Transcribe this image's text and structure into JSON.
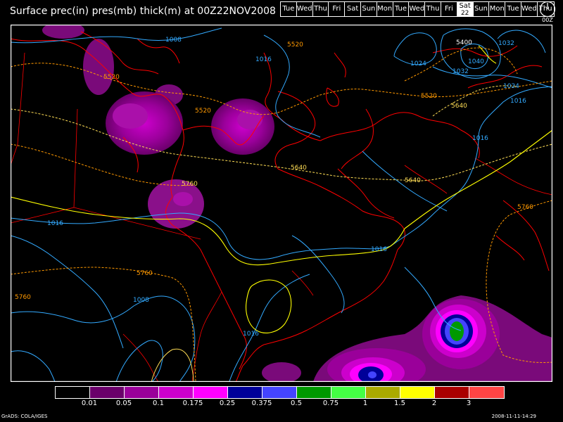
{
  "title": "Surface prec(in) pres(mb) thick(m) at 00Z22NOV2008",
  "days": [
    {
      "label": "Tue"
    },
    {
      "label": "Wed"
    },
    {
      "label": "Thu"
    },
    {
      "label": "Fri"
    },
    {
      "label": "Sat"
    },
    {
      "label": "Sun"
    },
    {
      "label": "Mon"
    },
    {
      "label": "Tue"
    },
    {
      "label": "Wed"
    },
    {
      "label": "Thu"
    },
    {
      "label": "Fri"
    },
    {
      "label": "Sat",
      "sub": "22",
      "active": true
    },
    {
      "label": "Sun"
    },
    {
      "label": "Mon"
    },
    {
      "label": "Tue"
    },
    {
      "label": "Wed"
    },
    {
      "label": "Thu"
    }
  ],
  "clock_label": "00Z",
  "map": {
    "pressure_labels": [
      "1008",
      "1016",
      "1024",
      "1032",
      "1040",
      "1016",
      "1024",
      "1032",
      "1016",
      "1016",
      "1016",
      "1008",
      "1016"
    ],
    "thickness_labels": [
      "5400",
      "5520",
      "5520",
      "5520",
      "5520",
      "5640",
      "5640",
      "5640",
      "5760",
      "5760",
      "5760",
      "5760"
    ],
    "colors": {
      "coastline": "#ff0000",
      "pressure": "#33aaff",
      "thickness_cold": "#ff9900",
      "thickness_warm": "#ffff66",
      "thickness_high": "#ffff00"
    }
  },
  "legend": {
    "colors": [
      "#000000",
      "#6a006a",
      "#9a009a",
      "#cc00cc",
      "#ff00ff",
      "#000099",
      "#4444ff",
      "#009900",
      "#44ff44",
      "#aaaa00",
      "#ffff00",
      "#aa0000",
      "#ff4444"
    ],
    "labels": [
      "0.01",
      "0.05",
      "0.1",
      "0.175",
      "0.25",
      "0.375",
      "0.5",
      "0.75",
      "1",
      "1.5",
      "2",
      "3"
    ]
  },
  "footer_left": "GrADS: COLA/IGES",
  "footer_right": "2008-11-11-14:29"
}
